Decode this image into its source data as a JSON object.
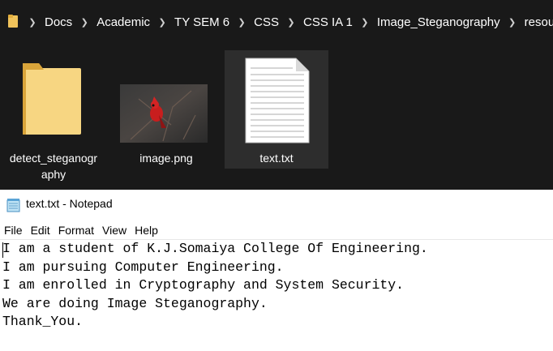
{
  "explorer": {
    "breadcrumb": [
      "Docs",
      "Academic",
      "TY SEM 6",
      "CSS",
      "CSS IA 1",
      "Image_Steganography",
      "resources"
    ],
    "files": [
      {
        "name": "detect_steganography",
        "line1": "detect_steganogr",
        "line2": "aphy",
        "kind": "folder"
      },
      {
        "name": "image.png",
        "kind": "image"
      },
      {
        "name": "text.txt",
        "kind": "text-file",
        "selected": true
      }
    ],
    "colors": {
      "background": "#191919",
      "selected": "#2d2d2d",
      "folder": "#f5d27a"
    }
  },
  "notepad": {
    "title": "text.txt - Notepad",
    "menu": [
      "File",
      "Edit",
      "Format",
      "View",
      "Help"
    ],
    "lines": [
      "I am a student of K.J.Somaiya College Of Engineering.",
      "I am pursuing Computer Engineering.",
      "I am enrolled in Cryptography and System Security.",
      "We are doing Image Steganography.",
      "Thank_You."
    ]
  }
}
